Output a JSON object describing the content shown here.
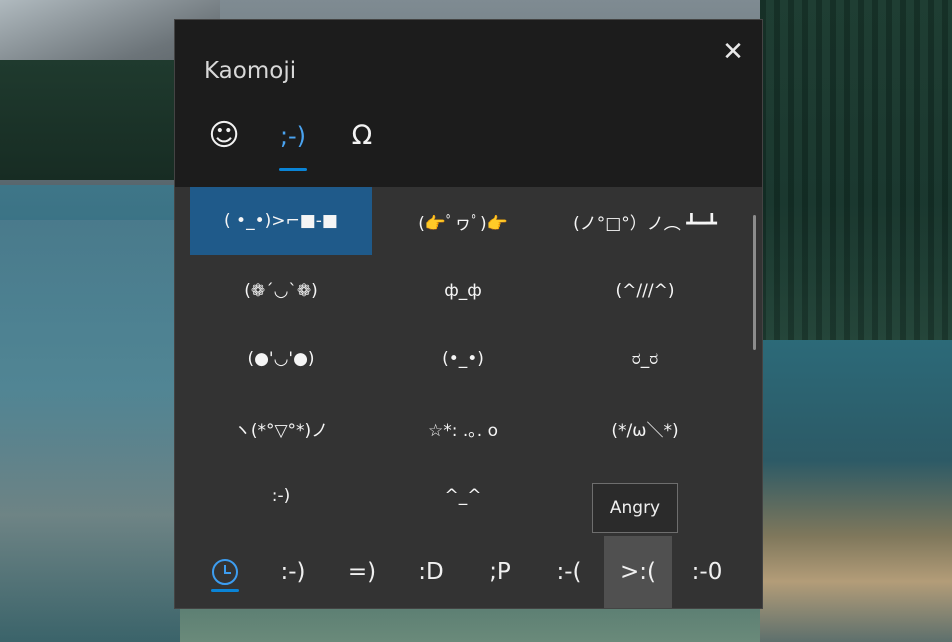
{
  "panel": {
    "title": "Kaomoji",
    "close_icon": "close-icon",
    "tabs": [
      {
        "label": "☺",
        "icon": "smiley-icon"
      },
      {
        "label": ";-)",
        "icon": "kaomoji-icon",
        "selected": true
      },
      {
        "label": "Ω",
        "icon": "omega-icon"
      }
    ]
  },
  "kaomoji_grid": [
    "( •_•)>⌐■-■",
    "(👉ﾟヮﾟ)👉",
    "(ノ°□°）ノ︵ ┻━┻",
    "(❁´◡`❁)",
    "ф_ф",
    "(^///^)",
    "(●'◡'●)",
    "(•_•)",
    "ರ_ರ",
    "ヽ(*°▽°*)ノ",
    "☆*: .｡. o",
    "(*/ω＼*)",
    ":-)",
    "^_^",
    ""
  ],
  "tooltip": "Angry",
  "categories": [
    {
      "label": "",
      "icon": "clock-icon",
      "name": "recent"
    },
    {
      "label": ":-)",
      "name": "happy"
    },
    {
      "label": "=)",
      "name": "smile"
    },
    {
      "label": ":D",
      "name": "laugh"
    },
    {
      "label": ";P",
      "name": "wink"
    },
    {
      "label": ":-(",
      "name": "sad"
    },
    {
      "label": ">:(",
      "name": "angry"
    },
    {
      "label": ":-0",
      "name": "surprised"
    }
  ],
  "colors": {
    "accent": "#0a84d6",
    "selected_cell": "#1f5a8a",
    "panel_bg": "#333333",
    "header_bg": "#1c1c1c"
  }
}
